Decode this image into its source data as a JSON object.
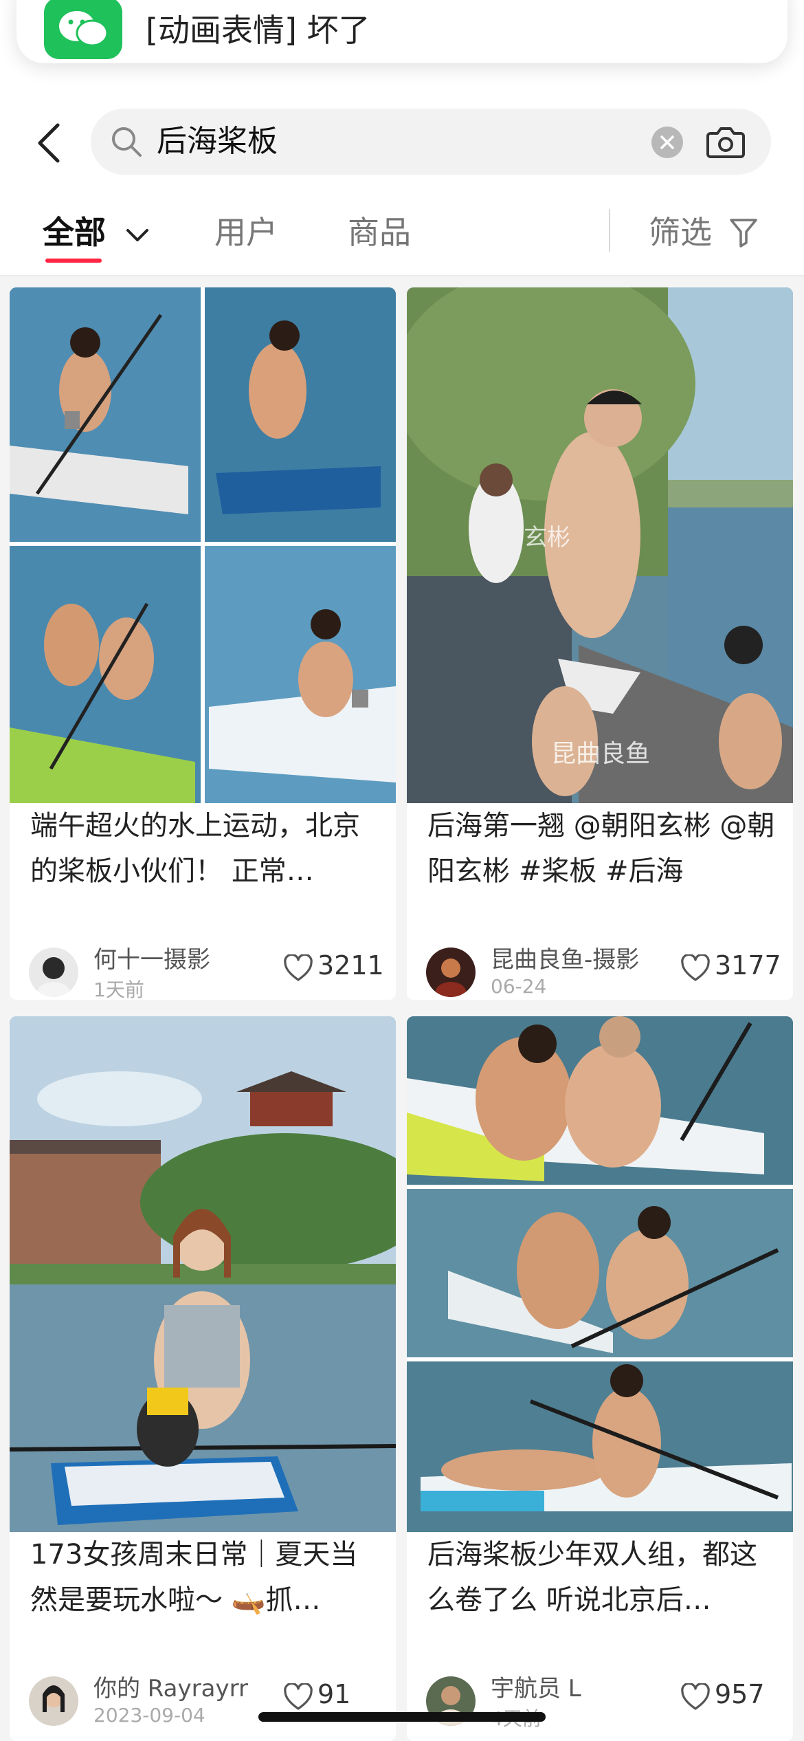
{
  "notification": {
    "message": "[动画表情] 坏了",
    "app_icon": "wechat-icon"
  },
  "search": {
    "query": "后海桨板",
    "back_icon": "chevron-left-icon",
    "clear_icon": "clear-icon",
    "camera_icon": "camera-icon"
  },
  "tabs": {
    "all": "全部",
    "users": "用户",
    "goods": "商品",
    "filter": "筛选",
    "active": "all",
    "accent": "#ff2442"
  },
  "posts": [
    {
      "title": "端午超火的水上运动，北京的桨板小伙们！ 正常…",
      "author": "何十一摄影",
      "date": "1天前",
      "likes": "3211"
    },
    {
      "title": "后海第一翘 @朝阳玄彬 @朝阳玄彬 #桨板 #后海",
      "author": "昆曲良鱼-摄影",
      "date": "06-24",
      "likes": "3177",
      "watermarks": [
        "玄彬",
        "昆曲良鱼"
      ]
    },
    {
      "title": "173女孩周末日常｜夏天当然是要玩水啦～ 🛶抓…",
      "author": "你的 Rayrayrr",
      "date": "2023-09-04",
      "likes": "91"
    },
    {
      "title": "后海桨板少年双人组，都这么卷了么 听说北京后…",
      "author": "宇航员 L",
      "date": "4天前",
      "likes": "957"
    }
  ]
}
